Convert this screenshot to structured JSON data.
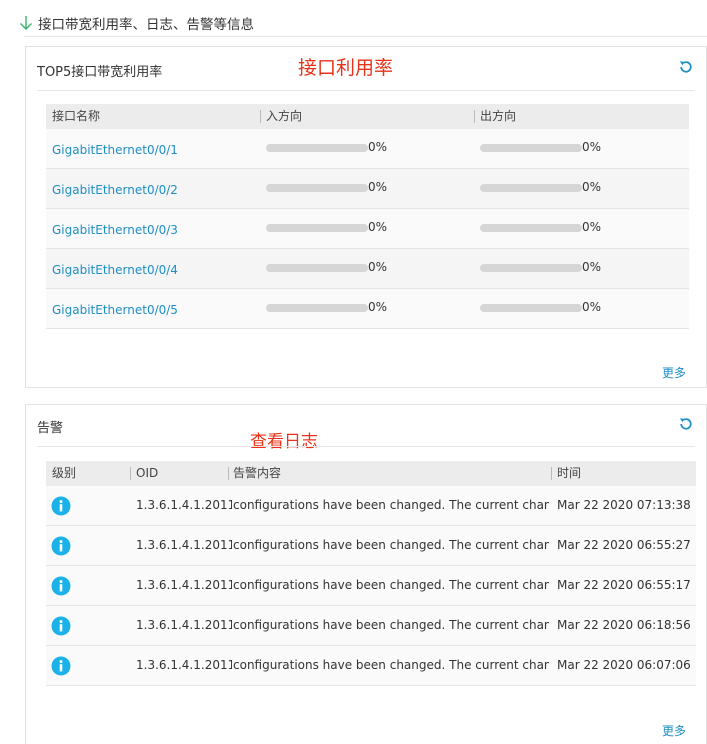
{
  "section": {
    "title": "接口带宽利用率、日志、告警等信息"
  },
  "bandwidth_panel": {
    "title": "TOP5接口带宽利用率",
    "annotation": "接口利用率",
    "columns": [
      "接口名称",
      "入方向",
      "出方向"
    ],
    "rows": [
      {
        "name": "GigabitEthernet0/0/1",
        "in": "0%",
        "out": "0%"
      },
      {
        "name": "GigabitEthernet0/0/2",
        "in": "0%",
        "out": "0%"
      },
      {
        "name": "GigabitEthernet0/0/3",
        "in": "0%",
        "out": "0%"
      },
      {
        "name": "GigabitEthernet0/0/4",
        "in": "0%",
        "out": "0%"
      },
      {
        "name": "GigabitEthernet0/0/5",
        "in": "0%",
        "out": "0%"
      }
    ],
    "more_label": "更多"
  },
  "alarm_panel": {
    "title": "告警",
    "annotation": "查看日志",
    "columns": [
      "级别",
      "OID",
      "告警内容",
      "时间"
    ],
    "rows": [
      {
        "level": "info",
        "oid": "1.3.6.1.4.1.2011...",
        "content": "configurations have been changed. The current change n...",
        "time": "Mar 22 2020 07:13:38"
      },
      {
        "level": "info",
        "oid": "1.3.6.1.4.1.2011...",
        "content": "configurations have been changed. The current change n...",
        "time": "Mar 22 2020 06:55:27"
      },
      {
        "level": "info",
        "oid": "1.3.6.1.4.1.2011...",
        "content": "configurations have been changed. The current change n...",
        "time": "Mar 22 2020 06:55:17"
      },
      {
        "level": "info",
        "oid": "1.3.6.1.4.1.2011...",
        "content": "configurations have been changed. The current change n...",
        "time": "Mar 22 2020 06:18:56"
      },
      {
        "level": "info",
        "oid": "1.3.6.1.4.1.2011...",
        "content": "configurations have been changed. The current change n...",
        "time": "Mar 22 2020 06:07:06"
      }
    ],
    "more_label": "更多"
  },
  "colors": {
    "link": "#1f8ec6",
    "annotation": "#e8331a",
    "info_icon": "#1ab2e8",
    "bar_track": "#d6d6d6",
    "header_arrow": "#3bb36b"
  },
  "icons": {
    "section_arrow": "arrow-down-icon",
    "refresh": "refresh-icon",
    "level_info": "info-icon"
  }
}
